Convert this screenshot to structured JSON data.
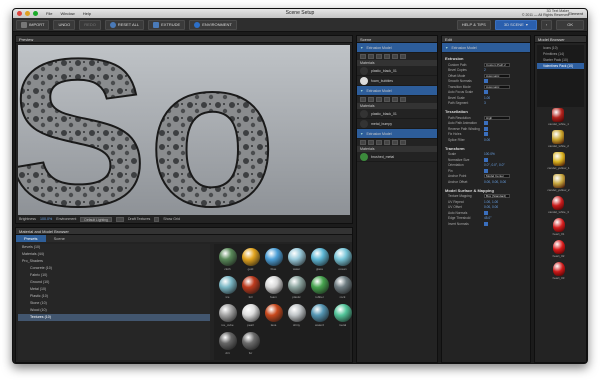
{
  "window": {
    "title": "Scene Setup",
    "menus": [
      "File",
      "Window",
      "Help"
    ],
    "info_line1": "3D Text Maker",
    "info_line2": "© 2011 — All Rights Reserved",
    "user": "Element"
  },
  "toolbar": {
    "import": "IMPORT",
    "undo": "UNDO",
    "redo": "REDO",
    "reset_all": "RESET ALL",
    "extrude": "EXTRUDE",
    "environment": "ENVIRONMENT",
    "help": "HELP & TIPS",
    "scene": "3D SCENE",
    "ok": "OK"
  },
  "preview": {
    "title": "Preview",
    "brightness_label": "Brightness",
    "brightness_value": "100.0%",
    "environment_label": "Environment",
    "environment_value": "Default Lighting",
    "draft_textures": "Draft Textures",
    "show_grid": "Show Grid",
    "viewport_text": "So"
  },
  "browser": {
    "title": "Material and Model Browser",
    "tabs": [
      "Presets",
      "Scene"
    ],
    "tree": [
      "Bevels (10)",
      "Materials (44)",
      "Pro_Shaders",
      "Concrete (10)",
      "Fabric (10)",
      "Ground (10)",
      "Metal (10)",
      "Plastic (10)",
      "Stone (10)",
      "Wood (10)",
      "Textures (10)"
    ],
    "materials": [
      {
        "name": "cloth",
        "color": "#5a8a5a"
      },
      {
        "name": "gold",
        "color": "#e3a520"
      },
      {
        "name": "blue",
        "color": "#4da0d8"
      },
      {
        "name": "water",
        "color": "#9acbdc"
      },
      {
        "name": "glass",
        "color": "#5fb8d6"
      },
      {
        "name": "ocean",
        "color": "#79c6d9"
      },
      {
        "name": "ice",
        "color": "#7bb8c6"
      },
      {
        "name": "foil",
        "color": "#bd3b1e"
      },
      {
        "name": "foam",
        "color": "#d9d9d9"
      },
      {
        "name": "plastic",
        "color": "#8ea6a1"
      },
      {
        "name": "rubber",
        "color": "#47a44f"
      },
      {
        "name": "rock",
        "color": "#6f7d82"
      },
      {
        "name": "ice_cube",
        "color": "#a4a4a4"
      },
      {
        "name": "pearl",
        "color": "#dedede"
      },
      {
        "name": "lava",
        "color": "#c9491d"
      },
      {
        "name": "shiny",
        "color": "#c0c5c8"
      },
      {
        "name": "water2",
        "color": "#5596b3"
      },
      {
        "name": "metal",
        "color": "#53c59a"
      },
      {
        "name": "dirt",
        "color": "#666666"
      },
      {
        "name": "fur",
        "color": "#6c6c6c"
      }
    ]
  },
  "scene": {
    "title": "Scene",
    "model_label": "Extrusion Model",
    "material_label": "Materials",
    "items": [
      "plastic_black_01",
      "foam_bubbles",
      "plastic_black_01",
      "metal_bumpy",
      "brushed_metal"
    ]
  },
  "edit": {
    "title": "Edit",
    "header": "Extrusion Model",
    "sections": [
      {
        "name": "Extrusion",
        "rows": [
          [
            "Custom Path",
            "Custom Path 2"
          ],
          [
            "Bevel Copies",
            "2"
          ],
          [
            "Offset Mode",
            "Automatic"
          ],
          [
            "Smooth Normals",
            ""
          ],
          [
            "Transition Mode",
            "Automatic"
          ],
          [
            "Auto Focus Scale",
            ""
          ],
          [
            "Bevel Scale",
            "1.00"
          ],
          [
            "Path Segment",
            "3"
          ]
        ]
      },
      {
        "name": "Tessellation",
        "rows": [
          [
            "Path Resolution",
            "High"
          ],
          [
            "Auto Path Animation",
            ""
          ],
          [
            "Reverse Path Winding",
            ""
          ],
          [
            "Fix Holes",
            ""
          ],
          [
            "Splice Filter",
            "0.00"
          ]
        ]
      },
      {
        "name": "Transform",
        "rows": [
          [
            "Scale",
            "100.0%"
          ],
          [
            "Normalize Size",
            ""
          ],
          [
            "Orientation",
            "0.0°, 0.0°, 0.0°"
          ],
          [
            "Pin",
            ""
          ],
          [
            "Anchor Point",
            "Model Center"
          ],
          [
            "Anchor Offset",
            "0.00, 0.00, 0.00"
          ]
        ]
      },
      {
        "name": "Model Surface & Mapping",
        "rows": [
          [
            "Texture Mapping",
            "Box (Standard)"
          ],
          [
            "UV Repeat",
            "1.00, 1.00"
          ],
          [
            "UV Offset",
            "0.00, 0.00"
          ],
          [
            "Auto Normals",
            ""
          ],
          [
            "Edge Threshold",
            "45.0°"
          ],
          [
            "Invert Normals",
            ""
          ]
        ]
      }
    ]
  },
  "models": {
    "title": "Model Browser",
    "list": [
      "Icons (10)",
      "Primitives (14)",
      "Starter Pack (10)",
      "Valentines Pack (10)"
    ],
    "thumbs": [
      {
        "name": "candel_white_1",
        "color": "#b2221c"
      },
      {
        "name": "candel_white_2",
        "color": "#c7a42b"
      },
      {
        "name": "candel_yellow_1",
        "color": "#d8b21f"
      },
      {
        "name": "candel_yellow_2",
        "color": "#c5a53c"
      },
      {
        "name": "candel_white_3",
        "color": "#c91b1b"
      },
      {
        "name": "heart_01",
        "color": "#d41d1d"
      },
      {
        "name": "heart_02",
        "color": "#d81919"
      },
      {
        "name": "heart_03",
        "color": "#cc1818"
      }
    ]
  }
}
